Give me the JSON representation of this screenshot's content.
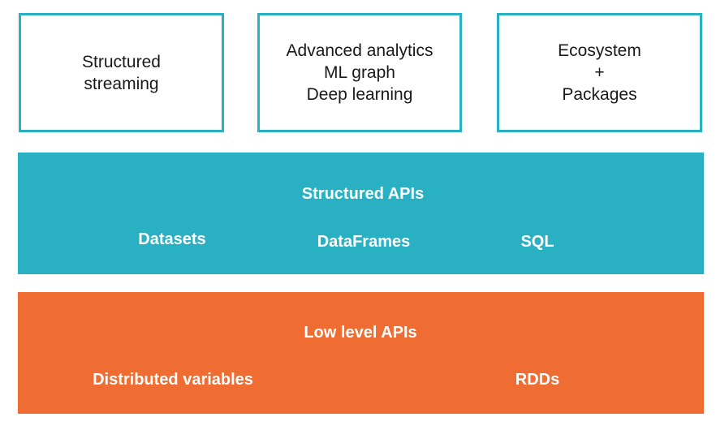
{
  "top_boxes": [
    {
      "lines": [
        "Structured",
        "streaming"
      ]
    },
    {
      "lines": [
        "Advanced analytics",
        "ML graph",
        "Deep learning"
      ]
    },
    {
      "lines": [
        "Ecosystem",
        "+",
        "Packages"
      ]
    }
  ],
  "structured_apis": {
    "title": "Structured APIs",
    "items": [
      "Datasets",
      "DataFrames",
      "SQL"
    ]
  },
  "low_level_apis": {
    "title": "Low level APIs",
    "items": [
      "Distributed variables",
      "RDDs"
    ]
  },
  "colors": {
    "teal": "#29b1c3",
    "orange": "#ef6c33",
    "text_dark": "#1a1a1a",
    "text_light": "#ffffff"
  }
}
